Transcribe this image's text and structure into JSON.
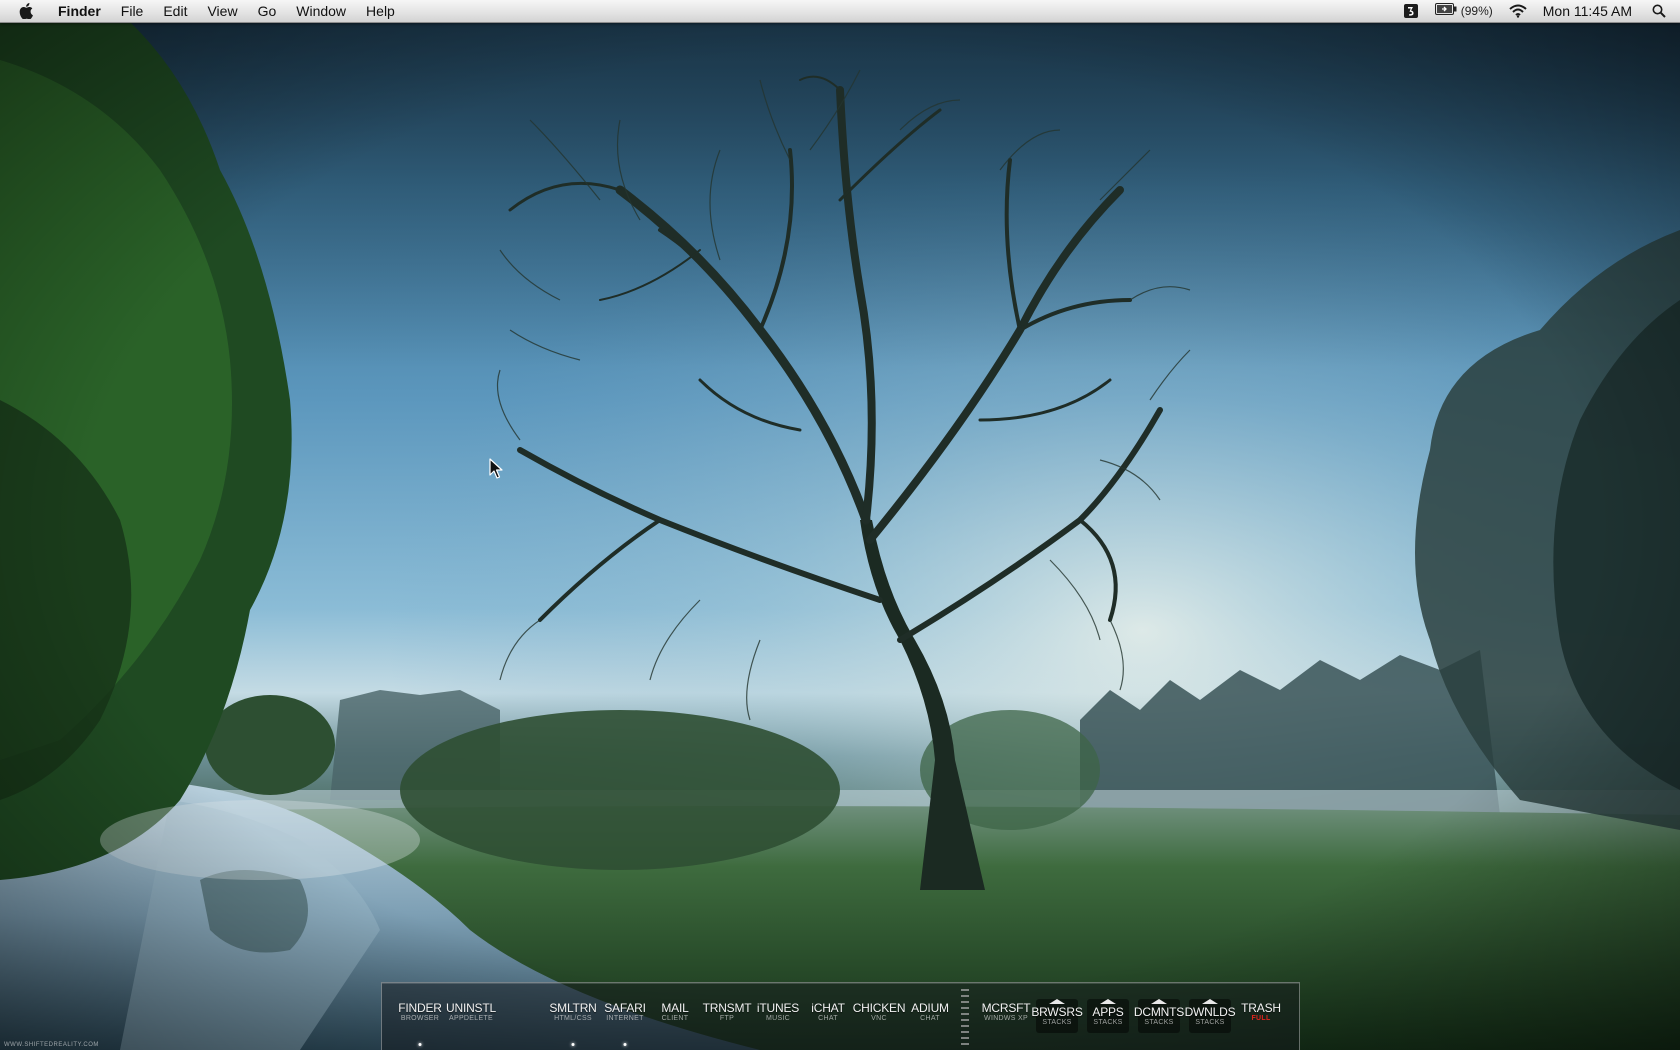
{
  "menubar": {
    "apple_icon": "apple-logo-icon",
    "app_name": "Finder",
    "menus": [
      "File",
      "Edit",
      "View",
      "Go",
      "Window",
      "Help"
    ],
    "status": {
      "sync_icon": "status-app-icon",
      "battery_icon": "battery-charging-icon",
      "battery_percent": "(99%)",
      "wifi_icon": "wifi-icon",
      "clock": "Mon 11:45 AM",
      "spotlight_icon": "spotlight-search-icon"
    }
  },
  "desktop": {
    "watermark": "WWW.SHIFTEDREALITY.COM"
  },
  "dock": {
    "items": [
      {
        "label": "FINDER",
        "sub": "BROWSER",
        "running": true
      },
      {
        "label": "UNINSTL",
        "sub": "APPDELETE",
        "running": false
      },
      {
        "label": "SMLTRN",
        "sub": "HTML/CSS",
        "running": true
      },
      {
        "label": "SAFARI",
        "sub": "INTERNET",
        "running": true
      },
      {
        "label": "MAIL",
        "sub": "CLIENT",
        "running": false
      },
      {
        "label": "TRNSMT",
        "sub": "FTP",
        "running": false
      },
      {
        "label": "iTUNES",
        "sub": "MUSIC",
        "running": false
      },
      {
        "label": "iCHAT",
        "sub": "CHAT",
        "running": false
      },
      {
        "label": "CHICKEN",
        "sub": "VNC",
        "running": false
      },
      {
        "label": "ADIUM",
        "sub": "CHAT",
        "running": false
      }
    ],
    "stacks": [
      {
        "label": "MCRSFT",
        "sub": "WINDWS XP",
        "stack": false
      },
      {
        "label": "BRWSRS",
        "sub": "STACKS",
        "stack": true
      },
      {
        "label": "APPS",
        "sub": "STACKS",
        "stack": true
      },
      {
        "label": "DCMNTS",
        "sub": "STACKS",
        "stack": true
      },
      {
        "label": "DWNLDS",
        "sub": "STACKS",
        "stack": true
      },
      {
        "label": "TRASH",
        "sub": "FULL",
        "stack": false
      }
    ],
    "colors": {
      "trash_full": "#e0241f"
    }
  }
}
